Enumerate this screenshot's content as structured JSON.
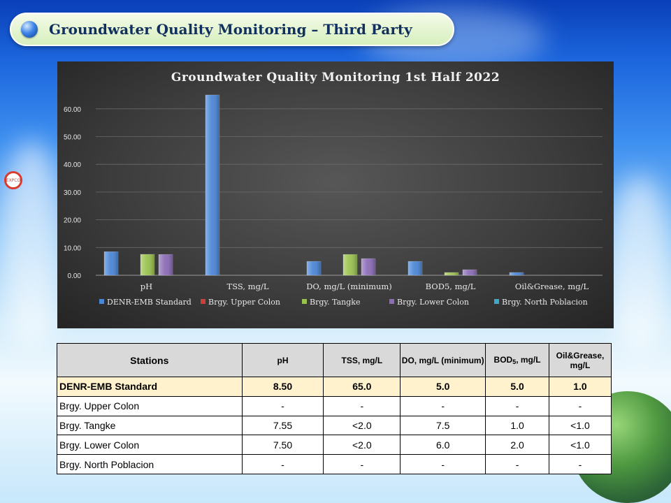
{
  "slide_title": "Groundwater Quality Monitoring – Third Party",
  "logo_text": "EXPCO",
  "chart_data": {
    "type": "bar",
    "title": "Groundwater Quality Monitoring 1st Half 2022",
    "categories": [
      "pH",
      "TSS, mg/L",
      "DO, mg/L (minimum)",
      "BOD5, mg/L",
      "Oil&Grease, mg/L"
    ],
    "series": [
      {
        "name": "DENR-EMB Standard",
        "color": "#4a86d6",
        "values": [
          8.5,
          65.0,
          5.0,
          5.0,
          1.0
        ]
      },
      {
        "name": "Brgy. Upper Colon",
        "color": "#c9403a",
        "values": [
          null,
          null,
          null,
          null,
          null
        ]
      },
      {
        "name": "Brgy. Tangke",
        "color": "#9bc24f",
        "values": [
          7.55,
          null,
          7.5,
          1.0,
          null
        ]
      },
      {
        "name": "Brgy. Lower Colon",
        "color": "#8b6cb6",
        "values": [
          7.5,
          null,
          6.0,
          2.0,
          null
        ]
      },
      {
        "name": "Brgy. North Poblacion",
        "color": "#3fa7c7",
        "values": [
          null,
          null,
          null,
          null,
          null
        ]
      }
    ],
    "yticks": [
      "0.00",
      "10.00",
      "20.00",
      "30.00",
      "40.00",
      "50.00",
      "60.00"
    ],
    "ylim": [
      0,
      70
    ],
    "grid": true,
    "legend": "bottom"
  },
  "table": {
    "headers": {
      "stations": "Stations",
      "ph": "pH",
      "tss": "TSS, mg/L",
      "do": "DO, mg/L (minimum)",
      "bod_pre": "BOD",
      "bod_sub": "5",
      "bod_post": ", mg/L",
      "oil_line1": "Oil&Grease,",
      "oil_line2": "mg/L"
    },
    "rows": [
      [
        "DENR-EMB Standard",
        "8.50",
        "65.0",
        "5.0",
        "5.0",
        "1.0"
      ],
      [
        "Brgy. Upper Colon",
        "-",
        "-",
        "-",
        "-",
        "-"
      ],
      [
        "Brgy. Tangke",
        "7.55",
        "<2.0",
        "7.5",
        "1.0",
        "<1.0"
      ],
      [
        "Brgy. Lower Colon",
        "7.50",
        "<2.0",
        "6.0",
        "2.0",
        "<1.0"
      ],
      [
        "Brgy. North Poblacion",
        "-",
        "-",
        "-",
        "-",
        "-"
      ]
    ]
  }
}
